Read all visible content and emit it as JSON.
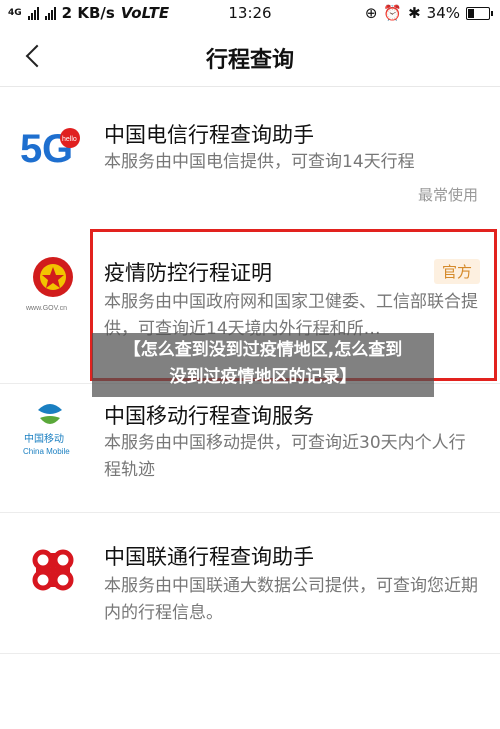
{
  "status_bar": {
    "network": "4G",
    "speed": "2 KB/s",
    "volte": "VoLTE",
    "time": "13:26",
    "battery": "34%",
    "battery_level": 0.34
  },
  "header": {
    "title": "行程查询"
  },
  "items": [
    {
      "title": "中国电信行程查询助手",
      "desc": "本服务由中国电信提供，可查询14天行程",
      "tag": "最常使用",
      "logo_text": "hello"
    },
    {
      "title": "疫情防控行程证明",
      "desc": "本服务由中国政府网和国家卫健委、工信部联合提供，可查询近14天境内外行程和所…",
      "tag": "官方",
      "logo_text": "www.GOV.cn"
    },
    {
      "title": "中国移动行程查询服务",
      "desc": "本服务由中国移动提供，可查询近30天内个人行程轨迹",
      "logo_text": "中国移动",
      "logo_text_en": "China Mobile"
    },
    {
      "title": "中国联通行程查询助手",
      "desc": "本服务由中国联通大数据公司提供，可查询您近期内的行程信息。"
    }
  ],
  "overlay": {
    "line1": "【怎么查到没到过疫情地区,怎么查到",
    "line2": "没到过疫情地区的记录】"
  },
  "colors": {
    "highlight": "#e2221e",
    "telecom_blue": "#1e6fcf",
    "telecom_red": "#e02020",
    "mobile_blue": "#1a7fc1",
    "mobile_green": "#5aa83a",
    "unicom_red": "#d7161f",
    "official_tag": "#d58a2a"
  }
}
